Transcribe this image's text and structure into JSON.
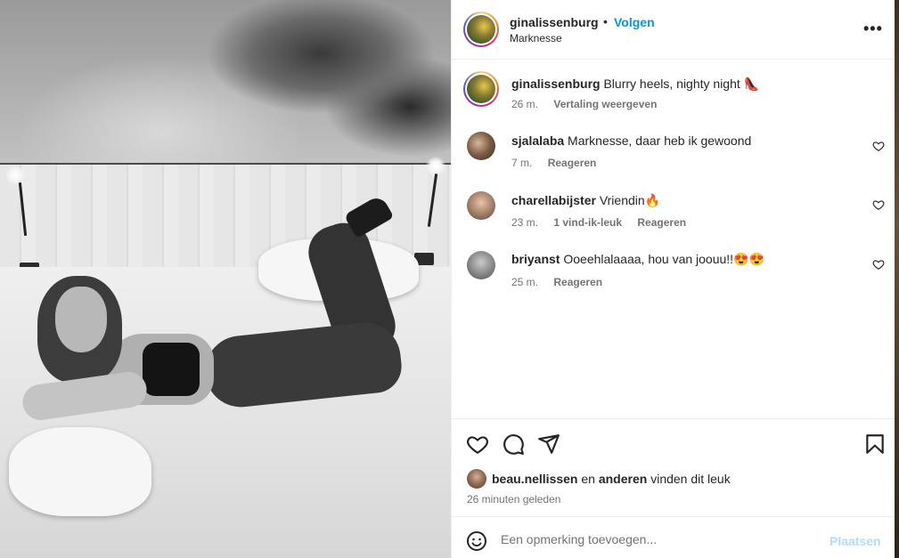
{
  "post": {
    "author": "ginalissenburg",
    "follow_label": "Volgen",
    "separator": "•",
    "location": "Marknesse",
    "more_icon": "more-horizontal-icon",
    "more_glyph": "•••"
  },
  "caption": {
    "username": "ginalissenburg",
    "text": "Blurry heels, nighty night 👠",
    "time": "26 m.",
    "translate_label": "Vertaling weergeven"
  },
  "comments": [
    {
      "username": "sjalalaba",
      "text": "Marknesse, daar heb ik gewoond",
      "time": "7 m.",
      "likes": "",
      "reply_label": "Reageren"
    },
    {
      "username": "charellabijster",
      "text": "Vriendin🔥",
      "time": "23 m.",
      "likes": "1 vind-ik-leuk",
      "reply_label": "Reageren"
    },
    {
      "username": "briyanst",
      "text": "Ooeehlalaaaa, hou van joouu!!😍😍",
      "time": "25 m.",
      "likes": "",
      "reply_label": "Reageren"
    }
  ],
  "likes": {
    "first_user": "beau.nellissen",
    "connector": "en",
    "others": "anderen",
    "suffix": "vinden dit leuk"
  },
  "timestamp": "26 minuten geleden",
  "composer": {
    "placeholder": "Een opmerking toevoegen...",
    "post_label": "Plaatsen",
    "emoji_icon": "smiley-icon"
  },
  "colors": {
    "accent": "#0095f6",
    "post_disabled": "#b3dbff",
    "secondary_text": "#737373",
    "text": "#262626"
  }
}
